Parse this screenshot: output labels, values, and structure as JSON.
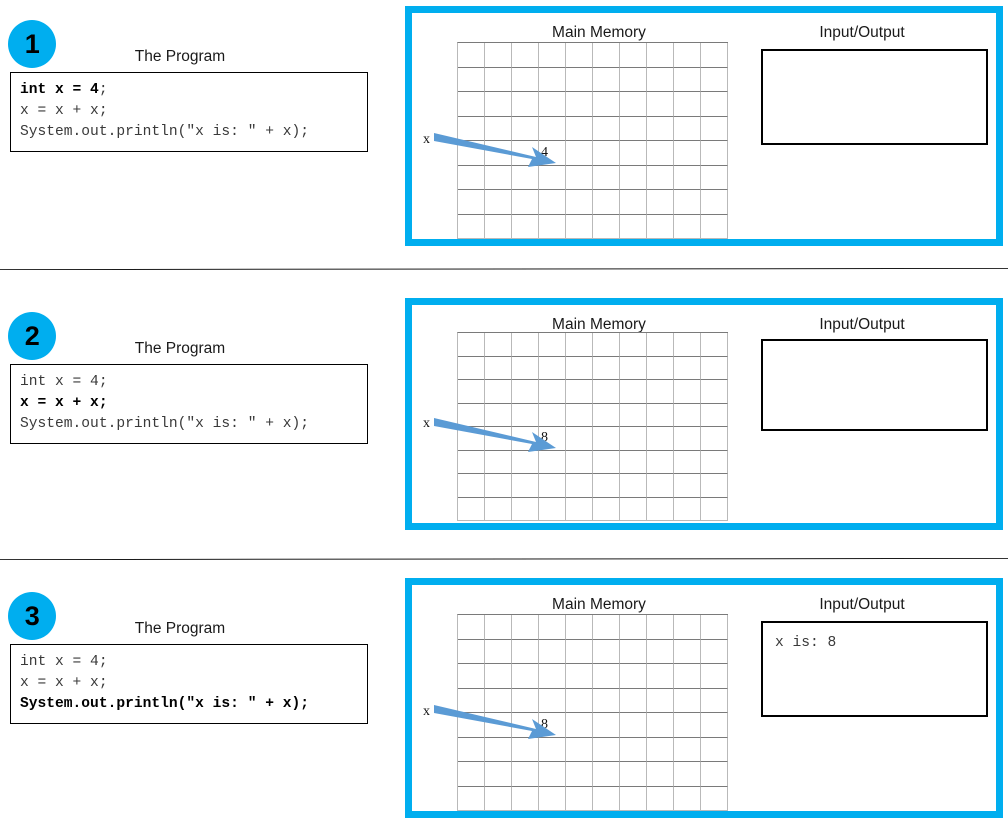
{
  "colors": {
    "badge_fill": "#00AEEF",
    "machine_border": "#00AEEF",
    "arrow": "#5B9BD5",
    "grid_line_dark": "#7a7a7a",
    "grid_line_light": "#b9b9b9",
    "code_text": "#3a3a3a",
    "highlight_text": "#000000",
    "separator": "#1a1a1a"
  },
  "labels": {
    "program_caption": "The Program",
    "main_memory": "Main Memory",
    "input_output": "Input/Output",
    "pointer": "x"
  },
  "grid": {
    "columns": 10,
    "rows": 8
  },
  "code": {
    "line1_bold": "int x = 4",
    "line1_plain": ";",
    "line1": "int x = 4;",
    "line2": "x = x + x;",
    "line3": "System.out.println(\"x is: \" + x);"
  },
  "panels": [
    {
      "step": "1",
      "caption": "The Program",
      "highlight_line": 1,
      "memory_title": "Main Memory",
      "io_title": "Input/Output",
      "pointer_label": "x",
      "memory_value": "4",
      "memory_cell_row": 5,
      "memory_cell_col": 4,
      "io_text": ""
    },
    {
      "step": "2",
      "caption": "The Program",
      "highlight_line": 2,
      "memory_title": "Main Memory",
      "io_title": "Input/Output",
      "pointer_label": "x",
      "memory_value": "8",
      "memory_cell_row": 5,
      "memory_cell_col": 4,
      "io_text": ""
    },
    {
      "step": "3",
      "caption": "The Program",
      "highlight_line": 3,
      "memory_title": "Main Memory",
      "io_title": "Input/Output",
      "pointer_label": "x",
      "memory_value": "8",
      "memory_cell_row": 5,
      "memory_cell_col": 4,
      "io_text": "x is: 8"
    }
  ]
}
